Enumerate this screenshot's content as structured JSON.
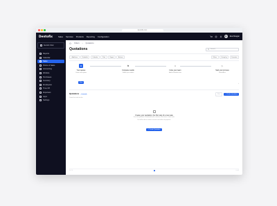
{
  "browser": {
    "url": "dentofix.com",
    "dot_colors": [
      "#ff5f57",
      "#febc2e",
      "#28c840"
    ]
  },
  "topnav": {
    "logo": "Dentofix",
    "items": [
      "Sales",
      "Services",
      "Products",
      "Reporting",
      "Configuration"
    ],
    "user_initials": "ED",
    "user_name": "Eva Dougan",
    "icon_names": [
      "cart-icon",
      "gear-icon",
      "notification-icon"
    ]
  },
  "sidebar": {
    "company": "Dentofix Clinic",
    "items": [
      {
        "label": "Reports",
        "icon": "reports-icon"
      },
      {
        "label": "Calendar",
        "icon": "calendar-icon"
      },
      {
        "label": "Sales",
        "icon": "sales-icon",
        "active": true
      },
      {
        "label": "Points of Sales",
        "icon": "pos-icon"
      },
      {
        "label": "Accounting",
        "icon": "accounting-icon"
      },
      {
        "label": "Website",
        "icon": "website-icon"
      },
      {
        "label": "Purchases",
        "icon": "purchases-icon"
      },
      {
        "label": "Inventory",
        "icon": "inventory-icon"
      },
      {
        "label": "Employees",
        "icon": "employees-icon"
      },
      {
        "label": "Time Off",
        "icon": "timeoff-icon"
      },
      {
        "label": "Expenses",
        "icon": "expenses-icon"
      },
      {
        "label": "Apps",
        "icon": "apps-icon"
      },
      {
        "label": "Settings",
        "icon": "settings-icon"
      }
    ],
    "accent": "#2563eb"
  },
  "breadcrumb": [
    "Orders",
    "Quotations"
  ],
  "page": {
    "title": "Quotations",
    "search_placeholder": "Search"
  },
  "toolbar": {
    "left": [
      "+ Add item",
      "Schedule",
      "Calendar",
      "Print",
      "Export",
      "Actions"
    ],
    "right": [
      "Filters",
      "Group by",
      "Favorites"
    ]
  },
  "steps": [
    {
      "badge": "A",
      "title": "Your quotes",
      "subtitle": "Create new quotes",
      "button": "Start"
    },
    {
      "badge": "⇆",
      "title": "Compare results",
      "subtitle": "Follow up on orders"
    },
    {
      "badge": "☺",
      "title": "Invite your team",
      "subtitle": "Add to Dentofix team"
    },
    {
      "badge": "▷",
      "title": "Start your process",
      "subtitle": "Send offers"
    }
  ],
  "section": {
    "title": "Quotations",
    "count": "0 records",
    "subtitle": "Create first sale for this",
    "ghost_button": "Filter",
    "primary_button": "+ Create Quotation"
  },
  "empty": {
    "title": "Create your quotation, the first step of a new sale",
    "subtitle_1": "Once the quotation is confirmed by the customer, it becomes a sales order.",
    "subtitle_2": "You will be able to create an invoice and collect the payment.",
    "button": "+ Create Quotation"
  },
  "footer": {
    "left": "1-0 / 0",
    "right": "0 of 0"
  }
}
